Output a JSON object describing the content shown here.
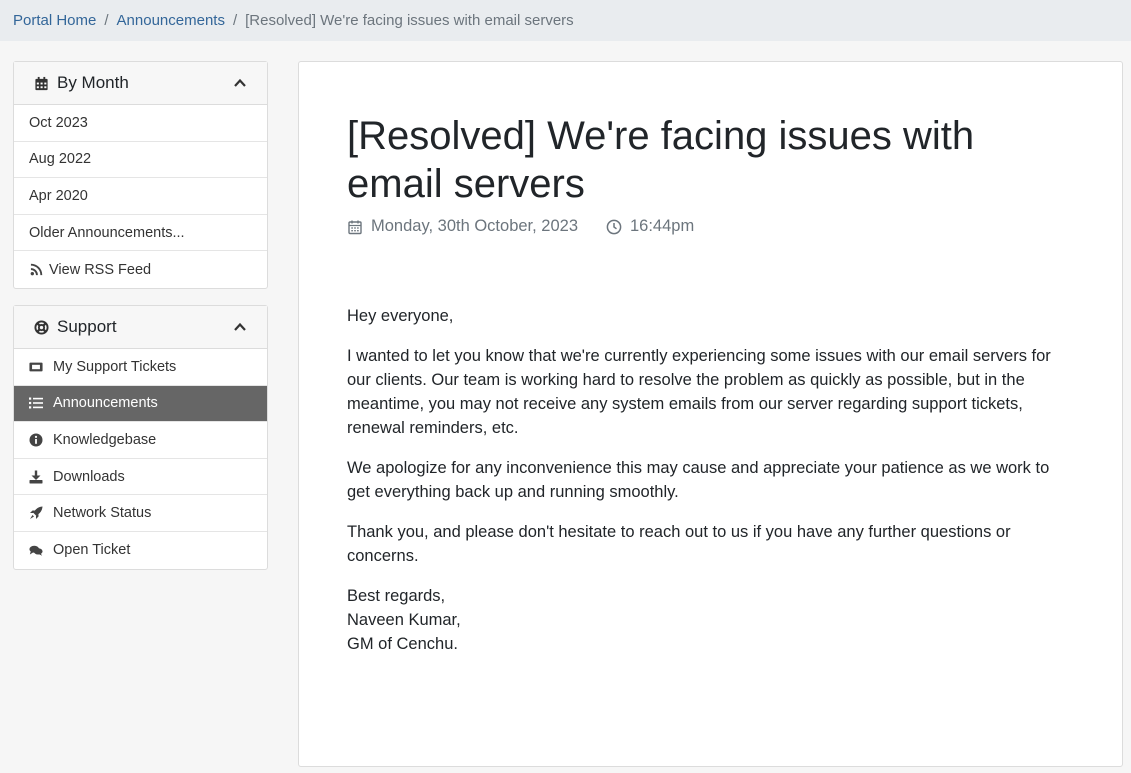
{
  "breadcrumb": {
    "home": "Portal Home",
    "section": "Announcements",
    "current": "[Resolved] We're facing issues with email servers",
    "separator": "/"
  },
  "by_month": {
    "title": "By Month",
    "icon": "calendar-icon",
    "items": [
      {
        "label": "Oct 2023"
      },
      {
        "label": "Aug 2022"
      },
      {
        "label": "Apr 2020"
      },
      {
        "label": "Older Announcements..."
      },
      {
        "label": "View RSS Feed",
        "icon": "rss-icon"
      }
    ]
  },
  "support": {
    "title": "Support",
    "icon": "life-ring-icon",
    "items": [
      {
        "label": "My Support Tickets",
        "icon": "ticket-icon"
      },
      {
        "label": "Announcements",
        "icon": "list-icon",
        "active": true
      },
      {
        "label": "Knowledgebase",
        "icon": "info-circle-icon"
      },
      {
        "label": "Downloads",
        "icon": "download-icon"
      },
      {
        "label": "Network Status",
        "icon": "rocket-icon"
      },
      {
        "label": "Open Ticket",
        "icon": "comments-icon"
      }
    ]
  },
  "article": {
    "title": "[Resolved] We're facing issues with email servers",
    "date": "Monday, 30th October, 2023",
    "time": "16:44pm",
    "paragraphs": [
      "Hey everyone,",
      "I wanted to let you know that we're currently experiencing some issues with our email servers for our clients. Our team is working hard to resolve the problem as quickly as possible, but in the meantime, you may not receive any system emails from our server regarding support tickets, renewal reminders, etc.",
      "We apologize for any inconvenience this may cause and appreciate your patience as we work to get everything back up and running smoothly.",
      "Thank you, and please don't hesitate to reach out to us if you have any further questions or concerns."
    ],
    "signoff": [
      "Best regards,",
      "Naveen Kumar,",
      "GM of Cenchu."
    ]
  },
  "colors": {
    "link": "#336699",
    "active_bg": "#666666",
    "muted": "#6c757d"
  }
}
